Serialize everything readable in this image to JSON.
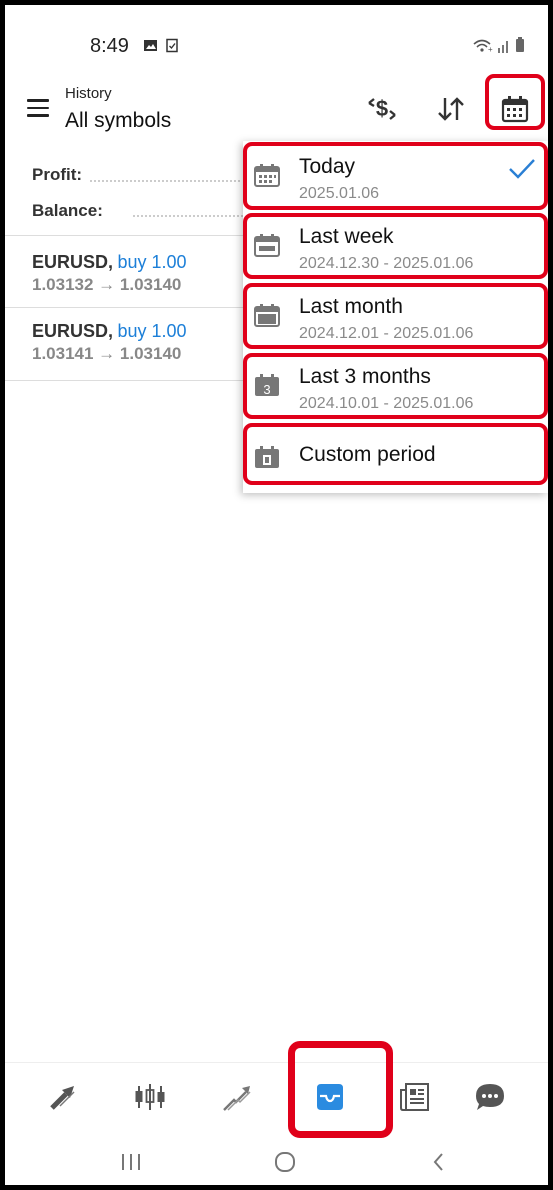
{
  "status": {
    "time": "8:49"
  },
  "header": {
    "subtitle": "History",
    "title": "All symbols",
    "icons": [
      "currency-icon",
      "sort-icon",
      "calendar-icon"
    ]
  },
  "summary": {
    "profit_label": "Profit:",
    "balance_label": "Balance:"
  },
  "deals": [
    {
      "symbol": "EURUSD,",
      "side": "buy 1.00",
      "prices": "1.03132 → 1.03140"
    },
    {
      "symbol": "EURUSD,",
      "side": "buy 1.00",
      "prices": "1.03141 → 1.03140"
    }
  ],
  "period_menu": {
    "items": [
      {
        "label": "Today",
        "range": "2025.01.06",
        "selected": true,
        "icon": "calendar-today-icon"
      },
      {
        "label": "Last week",
        "range": "2024.12.30 - 2025.01.06",
        "selected": false,
        "icon": "calendar-week-icon"
      },
      {
        "label": "Last month",
        "range": "2024.12.01 - 2025.01.06",
        "selected": false,
        "icon": "calendar-month-icon"
      },
      {
        "label": "Last 3 months",
        "range": "2024.10.01 - 2025.01.06",
        "selected": false,
        "icon": "calendar-3-months-icon",
        "badge": "3"
      },
      {
        "label": "Custom period",
        "range": "",
        "selected": false,
        "icon": "calendar-custom-icon"
      }
    ]
  },
  "bottom_nav": {
    "items": [
      "quotes-icon",
      "chart-icon",
      "trade-icon",
      "history-icon",
      "news-icon",
      "chat-icon"
    ],
    "active": "history-icon"
  },
  "colors": {
    "accent": "#1c7fd8",
    "highlight": "#e0001a",
    "active_nav": "#2a8be0"
  }
}
